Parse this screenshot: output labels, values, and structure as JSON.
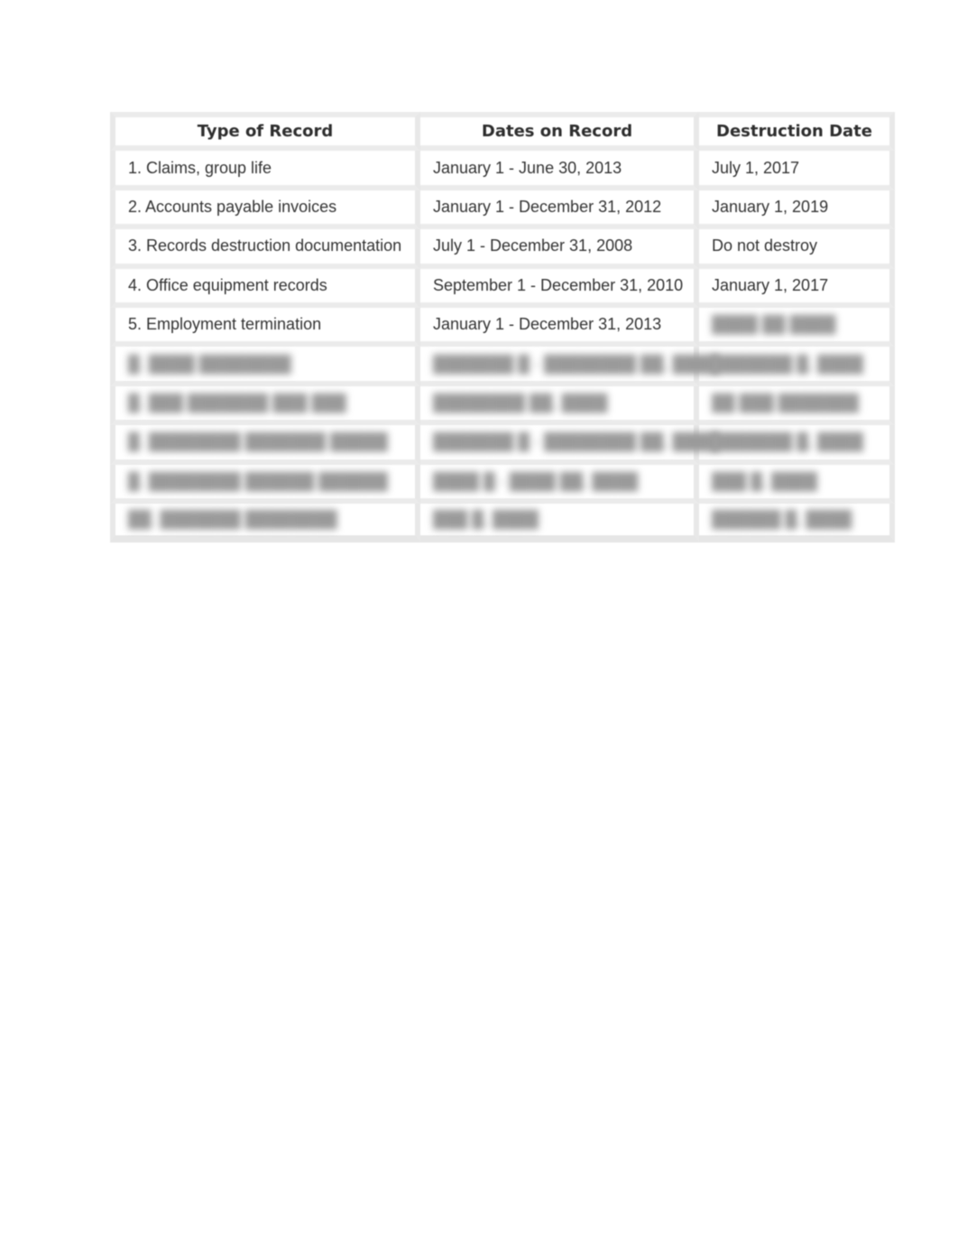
{
  "table": {
    "headers": [
      "Type of Record",
      "Dates on Record",
      "Destruction Date"
    ],
    "rows": [
      {
        "type": "1. Claims, group life",
        "dates": "January 1 - June 30, 2013",
        "destruction": "July 1, 2017"
      },
      {
        "type": "2. Accounts payable invoices",
        "dates": "January 1 - December 31, 2012",
        "destruction": "January 1, 2019"
      },
      {
        "type": "3. Records destruction documentation",
        "dates": "July 1 - December 31, 2008",
        "destruction": "Do not destroy"
      },
      {
        "type": "4. Office equipment records",
        "dates": "September 1 - December 31, 2010",
        "destruction": "January 1, 2017"
      },
      {
        "type": "5. Employment termination",
        "dates": "January 1 - December 31, 2013",
        "destruction": "████ ██ ████"
      }
    ],
    "obscured_rows": [
      {
        "type": "█. ████ ████████",
        "dates": "███████ █ - ████████ ██, ████",
        "destruction": "███████ █, ████"
      },
      {
        "type": "█. ███ ███████ ███ ███",
        "dates": "████████ ██, ████",
        "destruction": "██ ███ ███████"
      },
      {
        "type": "█. ████████ ███████ █████",
        "dates": "███████ █ - ████████ ██, ████",
        "destruction": "███████ █, ████"
      },
      {
        "type": "█. ████████ ██████ ██████",
        "dates": "████ █ - ████ ██, ████",
        "destruction": "███ █, ████"
      },
      {
        "type": "██. ███████ ████████",
        "dates": "███ █, ████",
        "destruction": "██████ █, ████"
      }
    ]
  }
}
